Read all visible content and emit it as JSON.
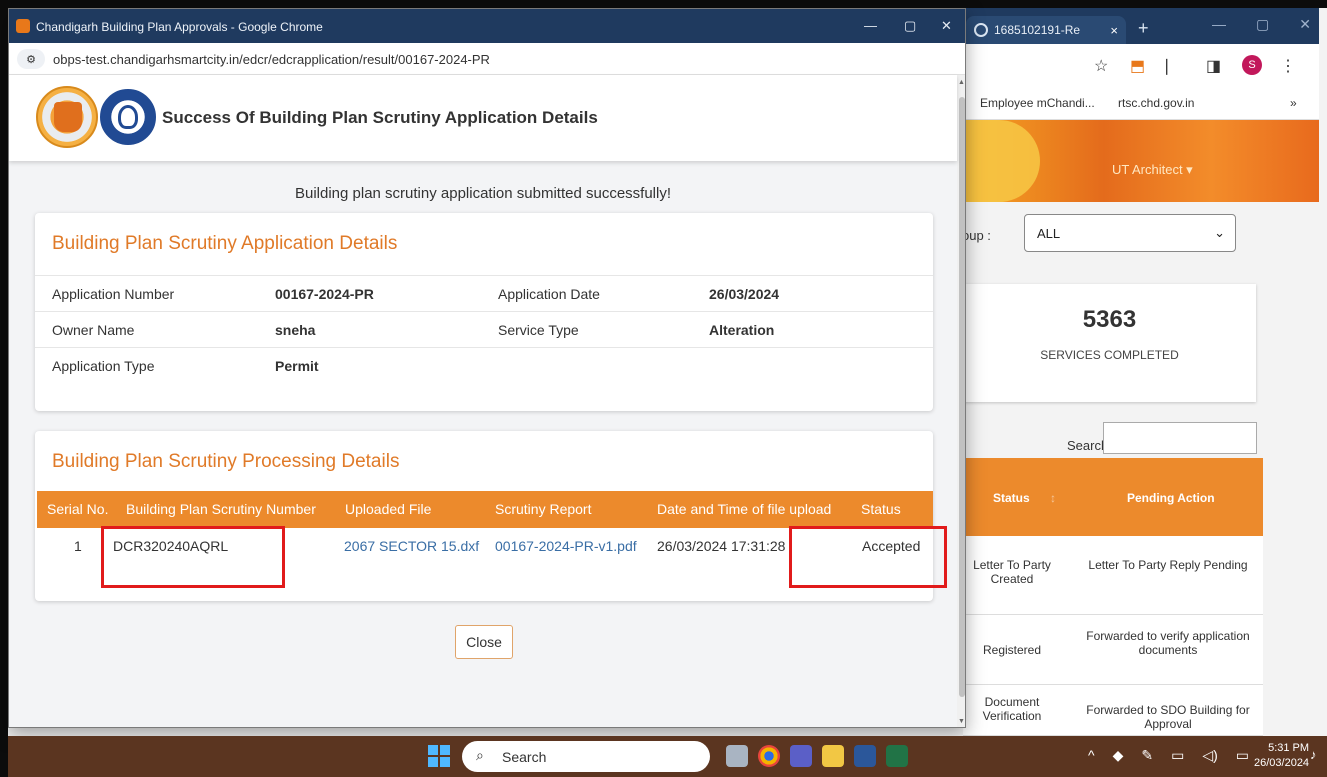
{
  "background_browser": {
    "tab_title": "1685102191-Re",
    "tab_close": "×",
    "new_tab": "+",
    "window_controls": [
      "—",
      "▢",
      "✕"
    ],
    "toolbar_icons": [
      "☆",
      "⬒",
      "❘",
      "◨",
      "⋮"
    ],
    "profile_initial": "S",
    "bookmarks": [
      "Employee mChandi...",
      "rtsc.chd.gov.in",
      "»"
    ],
    "user_menu": "UT Architect ▾",
    "group_label": "oup :",
    "group_select": "ALL",
    "services_count": "5363",
    "services_label": "SERVICES COMPLETED",
    "search_label": "Search:",
    "table_headers": [
      "Status",
      "Pending Action"
    ],
    "sort_icon": "↕",
    "rows": [
      {
        "status": "Letter To Party Created",
        "action": "Letter To Party Reply Pending"
      },
      {
        "status": "Registered",
        "action": "Forwarded to verify application documents"
      },
      {
        "status": "Document Verification",
        "action": "Forwarded to SDO Building for Approval"
      }
    ]
  },
  "popup": {
    "window_title": "Chandigarh Building Plan Approvals - Google Chrome",
    "window_controls": [
      "—",
      "▢",
      "✕"
    ],
    "url": "obps-test.chandigarhsmartcity.in/edcr/edcrapplication/result/00167-2024-PR",
    "page_title": "Success Of Building Plan Scrutiny Application Details",
    "success_message": "Building plan scrutiny application submitted successfully!",
    "application_details": {
      "title": "Building Plan Scrutiny Application Details",
      "rows": [
        {
          "label1": "Application Number",
          "value1": "00167-2024-PR",
          "label2": "Application Date",
          "value2": "26/03/2024"
        },
        {
          "label1": "Owner Name",
          "value1": "sneha",
          "label2": "Service Type",
          "value2": "Alteration"
        },
        {
          "label1": "Application Type",
          "value1": "Permit",
          "label2": "",
          "value2": ""
        }
      ]
    },
    "processing_details": {
      "title": "Building Plan Scrutiny Processing Details",
      "headers": [
        "Serial No.",
        "Building Plan Scrutiny Number",
        "Uploaded File",
        "Scrutiny Report",
        "Date and Time of file upload",
        "Status"
      ],
      "row": {
        "serial": "1",
        "scrutiny_number": "DCR320240AQRL",
        "uploaded_file": "2067 SECTOR 15.dxf",
        "scrutiny_report": "00167-2024-PR-v1.pdf",
        "datetime": "26/03/2024 17:31:28",
        "status": "Accepted"
      }
    },
    "close_button": "Close"
  },
  "taskbar": {
    "search_placeholder": "Search",
    "tray_icons": [
      "^",
      "◆",
      "✎",
      "▭",
      "◁)",
      "▭"
    ],
    "time": "5:31 PM",
    "date": "26/03/2024",
    "bell": "🔔"
  },
  "colors": {
    "accent_orange": "#ec8a2c",
    "title_orange": "#e07a28",
    "link_blue": "#3a6ea5",
    "highlight_red": "#e11b1b",
    "chrome_titlebar": "#1f3a5f"
  }
}
